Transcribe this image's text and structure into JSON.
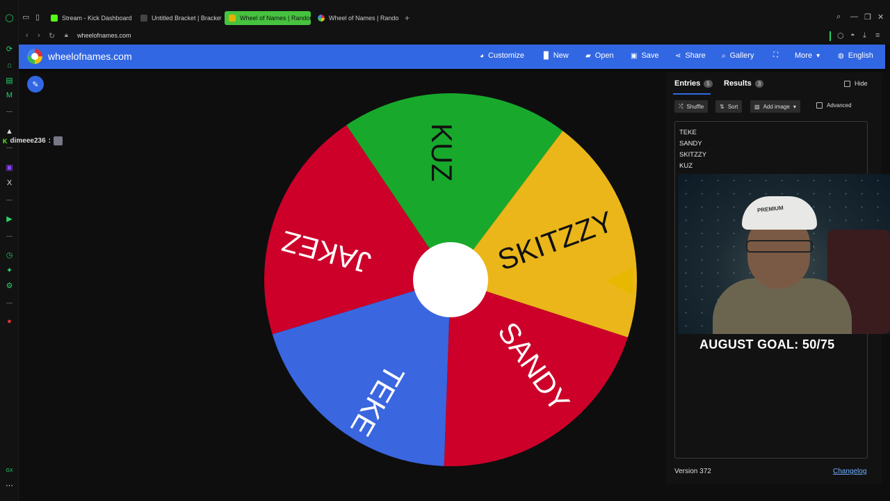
{
  "browser": {
    "tabs": [
      {
        "label": "Stream - Kick Dashboard",
        "color": "#53fc18"
      },
      {
        "label": "Untitled Bracket | Bracket",
        "color": "#444"
      },
      {
        "label": "Wheel of Names | Random",
        "color": "#e0b400"
      },
      {
        "label": "Wheel of Names | Random",
        "color": "#db3236"
      }
    ],
    "url": "wheelofnames.com"
  },
  "site": {
    "name": "wheelofnames.com",
    "nav": {
      "customize": "Customize",
      "new": "New",
      "open": "Open",
      "save": "Save",
      "share": "Share",
      "gallery": "Gallery",
      "more": "More",
      "language": "English"
    }
  },
  "chat": {
    "user": "dimeee236",
    "sep": ":"
  },
  "wheel": {
    "colors": {
      "green": "#18a92c",
      "yellow": "#eab61a",
      "red": "#cc0029",
      "blue": "#3a66e0"
    },
    "segments": [
      {
        "label": "KUZ",
        "color": "#18a92c"
      },
      {
        "label": "SKITZZY",
        "color": "#eab61a"
      },
      {
        "label": "SANDY",
        "color": "#cc0029"
      },
      {
        "label": "TEKE",
        "color": "#3a66e0"
      },
      {
        "label": "JAKEZ",
        "color": "#cc0029"
      }
    ]
  },
  "panel": {
    "entries_tab": "Entries",
    "entries_count": "5",
    "results_tab": "Results",
    "results_count": "3",
    "hide_label": "Hide",
    "shuffle": "Shuffle",
    "sort": "Sort",
    "add_image": "Add image",
    "advanced": "Advanced",
    "entries": [
      "TEKE",
      "SANDY",
      "SKITZZY",
      "KUZ"
    ],
    "version": "Version 372",
    "changelog": "Changelog"
  },
  "overlay": {
    "goal": "AUGUST GOAL: 50/75",
    "cap_text": "PREMIUM"
  }
}
